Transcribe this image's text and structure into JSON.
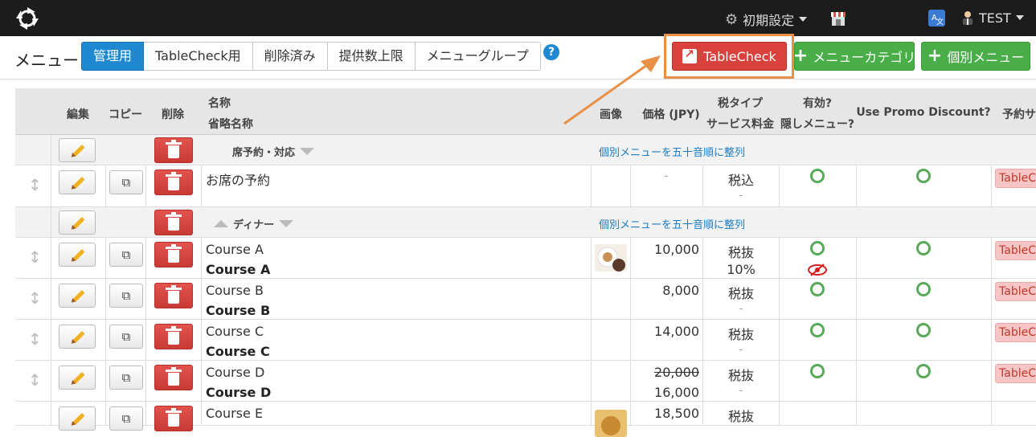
{
  "topbar": {
    "settings_label": "初期設定",
    "user_label": "TEST",
    "colors": {
      "bg": "#1c1c1c"
    }
  },
  "subbar": {
    "title": "メニュー",
    "tabs": [
      "管理用",
      "TableCheck用",
      "削除済み",
      "提供数上限",
      "メニューグループ"
    ],
    "active_tab": "管理用",
    "help_label": "?",
    "buttons": {
      "tablecheck": "TableCheck",
      "menu_category": "メニューカテゴリ",
      "individual_menu": "個別メニュー"
    }
  },
  "table": {
    "headers": {
      "edit": "編集",
      "copy": "コピー",
      "delete": "削除",
      "name": "名称",
      "short_name": "省略名称",
      "image": "画像",
      "price": "価格 (JPY)",
      "tax_type": "税タイプ",
      "service_fee": "サービス料金",
      "enabled": "有効?",
      "hidden_menu": "隠しメニュー?",
      "promo": "Use Promo Discount?",
      "reservation": "予約サ"
    },
    "sort_link": "個別メニューを五十音順に整列",
    "categories": [
      {
        "title": "席予約・対応"
      },
      {
        "title": "ディナー"
      }
    ],
    "rows": [
      {
        "name": "お席の予約",
        "short": "",
        "price": "-",
        "tax": "税込",
        "service": "-",
        "badge": "TableCh"
      },
      {
        "name": "Course A",
        "short": "Course A",
        "price": "10,000",
        "tax": "税抜",
        "service": "10%",
        "badge": "TableCh"
      },
      {
        "name": "Course B",
        "short": "Course B",
        "price": "8,000",
        "tax": "税抜",
        "service": "-",
        "badge": "TableCh"
      },
      {
        "name": "Course C",
        "short": "Course C",
        "price": "14,000",
        "tax": "税抜",
        "service": "-",
        "badge": "TableCh"
      },
      {
        "name": "Course D",
        "short": "Course D",
        "price_old": "20,000",
        "price": "16,000",
        "tax": "税抜",
        "service": "-",
        "badge": "TableCh"
      },
      {
        "name": "Course E",
        "short": "",
        "price": "18,500",
        "tax": "税抜",
        "service": "",
        "badge": ""
      }
    ]
  },
  "icons": {
    "logo": "logo-icon",
    "gear": "gear-icon",
    "store": "store-icon",
    "translate": "translate-icon",
    "user": "user-icon",
    "pencil": "pencil-icon",
    "copy": "copy-icon",
    "trash": "trash-icon",
    "move": "move-icon",
    "check": "circle-check-icon",
    "hidden": "eye-slash-icon"
  },
  "colors": {
    "accent": "#1e88d0",
    "danger": "#d9413c",
    "success": "#49ae48",
    "highlight": "#e89047"
  }
}
